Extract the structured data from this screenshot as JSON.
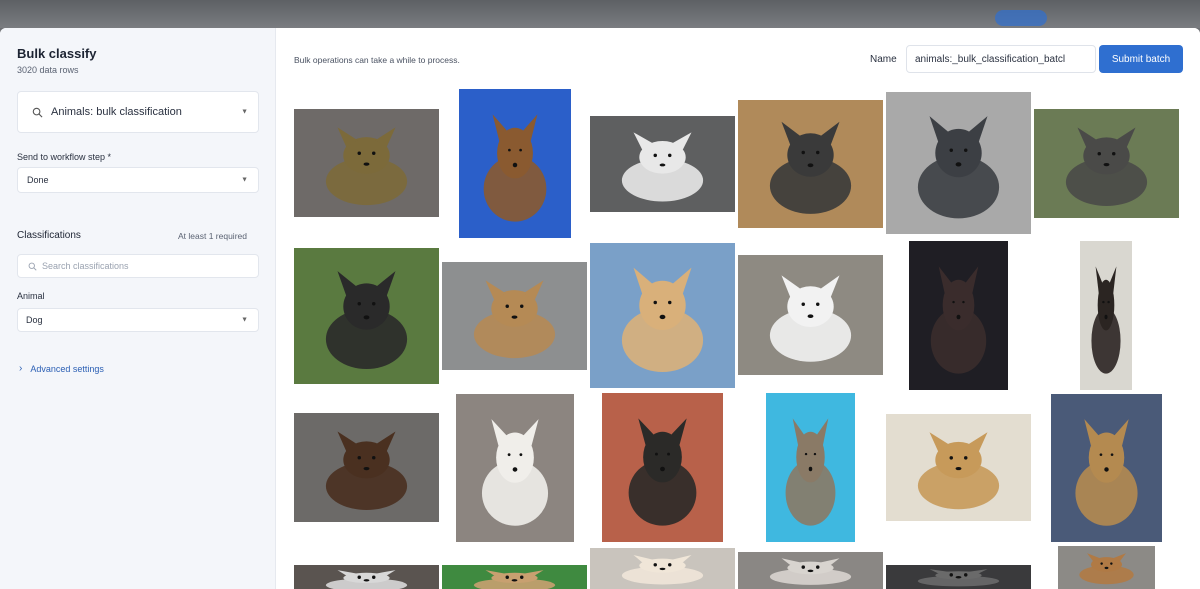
{
  "sidebar": {
    "title": "Bulk classify",
    "subtitle": "3020 data rows",
    "dataset_value": "Animals: bulk classification",
    "workflow_label": "Send to workflow step *",
    "workflow_value": "Done",
    "classifications_title": "Classifications",
    "classifications_hint": "At least 1 required",
    "search_placeholder": "Search classifications",
    "animal_label": "Animal",
    "animal_value": "Dog",
    "advanced_label": "Advanced settings"
  },
  "main": {
    "notice": "Bulk operations can take a while to process.",
    "name_label": "Name",
    "name_value": "animals:_bulk_classification_batcl",
    "submit_label": "Submit batch"
  },
  "images": [
    {
      "name": "dog-image-1",
      "bg": "#6e6a68",
      "body": "#7c6a3a"
    },
    {
      "name": "dog-image-2",
      "bg": "#2b5fc9",
      "body": "#8a5a30"
    },
    {
      "name": "dog-image-3",
      "bg": "#5e5f60",
      "body": "#e8e8e8"
    },
    {
      "name": "dog-image-4",
      "bg": "#b08a5a",
      "body": "#3a3a3a"
    },
    {
      "name": "dog-image-5",
      "bg": "#a9a9a9",
      "body": "#3c3f44"
    },
    {
      "name": "dog-image-6",
      "bg": "#6b7b55",
      "body": "#4a4a48"
    },
    {
      "name": "dog-image-7",
      "bg": "#5a7a40",
      "body": "#2a2a2a"
    },
    {
      "name": "dog-image-8",
      "bg": "#8d8f90",
      "body": "#b58a55"
    },
    {
      "name": "dog-image-9",
      "bg": "#7aa0c8",
      "body": "#d9b07a"
    },
    {
      "name": "dog-image-10",
      "bg": "#8e8a82",
      "body": "#f2f2f2"
    },
    {
      "name": "dog-image-11",
      "bg": "#1f1e24",
      "body": "#3a2c2c"
    },
    {
      "name": "dog-image-12",
      "bg": "#d9d7d0",
      "body": "#2b2522"
    },
    {
      "name": "dog-image-13",
      "bg": "#6c6a68",
      "body": "#4a3020"
    },
    {
      "name": "dog-image-14",
      "bg": "#8c8580",
      "body": "#f0eeea"
    },
    {
      "name": "dog-image-15",
      "bg": "#b8614a",
      "body": "#2b2a28"
    },
    {
      "name": "dog-image-16",
      "bg": "#3fb8e0",
      "body": "#8a7a66"
    },
    {
      "name": "dog-image-17",
      "bg": "#e3ddd0",
      "body": "#c79a5a"
    },
    {
      "name": "dog-image-18",
      "bg": "#4a5a78",
      "body": "#b48a50"
    },
    {
      "name": "dog-image-19",
      "bg": "#5a5450",
      "body": "#d8d8d8"
    },
    {
      "name": "dog-image-20",
      "bg": "#3f8a40",
      "body": "#c8a070"
    },
    {
      "name": "dog-image-21",
      "bg": "#c9c4bd",
      "body": "#f0e6d8"
    },
    {
      "name": "dog-image-22",
      "bg": "#8a8784",
      "body": "#d8d4cf"
    },
    {
      "name": "dog-image-23",
      "bg": "#3a3a3c",
      "body": "#6a6a6a"
    },
    {
      "name": "dog-image-24",
      "bg": "#8c8a86",
      "body": "#b07a45"
    }
  ]
}
